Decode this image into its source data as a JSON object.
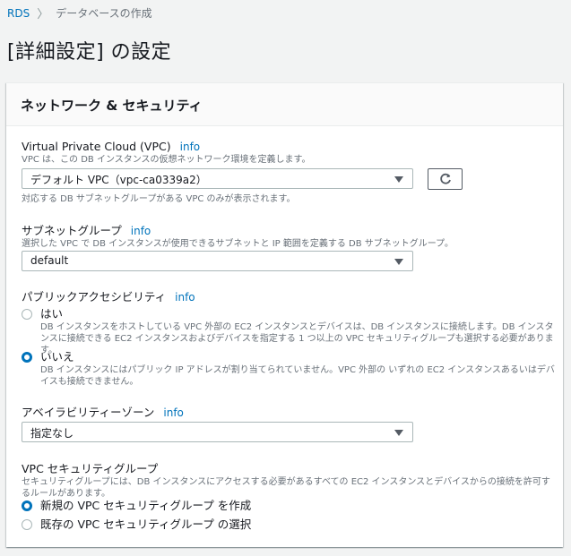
{
  "breadcrumb": {
    "items": [
      "RDS",
      "データベースの作成"
    ],
    "separator": ">"
  },
  "page": {
    "title": "[詳細設定] の設定"
  },
  "panel": {
    "title": "ネットワーク & セキュリティ",
    "vpc": {
      "label": "Virtual Private Cloud (VPC)",
      "info": "info",
      "description": "VPC は、この DB インスタンスの仮想ネットワーク環境を定義します。",
      "selected": "デフォルト VPC（vpc-ca0339a2）",
      "hint": "対応する DB サブネットグループがある VPC のみが表示されます。",
      "refresh_icon": "refresh-icon"
    },
    "subnet": {
      "label": "サブネットグループ",
      "info": "info",
      "description": "選択した VPC で DB インスタンスが使用できるサブネットと IP 範囲を定義する DB サブネットグループ。",
      "selected": "default"
    },
    "public_access": {
      "label": "パブリックアクセシビリティ",
      "info": "info",
      "options": [
        {
          "label": "はい",
          "description": "DB インスタンスをホストしている VPC 外部の EC2 インスタンスとデバイスは、DB インスタンスに接続します。DB インスタンスに接続できる EC2 インスタンスおよびデバイスを指定する 1 つ以上の VPC セキュリティグループも選択する必要があります。",
          "checked": false
        },
        {
          "label": "いいえ",
          "description": "DB インスタンスにはパブリック IP アドレスが割り当てられていません。VPC 外部の いずれの EC2 インスタンスあるいはデバイスも接続できません。",
          "checked": true
        }
      ]
    },
    "availability_zone": {
      "label": "アベイラビリティーゾーン",
      "info": "info",
      "selected": "指定なし"
    },
    "security_group": {
      "label": "VPC セキュリティグループ",
      "description": "セキュリティグループには、DB インスタンスにアクセスする必要があるすべての EC2 インスタンスとデバイスからの接続を許可するルールがあります。",
      "options": [
        {
          "label": "新規の VPC セキュリティグループ を作成",
          "checked": true
        },
        {
          "label": "既存の VPC セキュリティグループ の選択",
          "checked": false
        }
      ]
    }
  },
  "colors": {
    "accent": "#0073bb",
    "background": "#f2f3f3",
    "muted_text": "#687078"
  }
}
